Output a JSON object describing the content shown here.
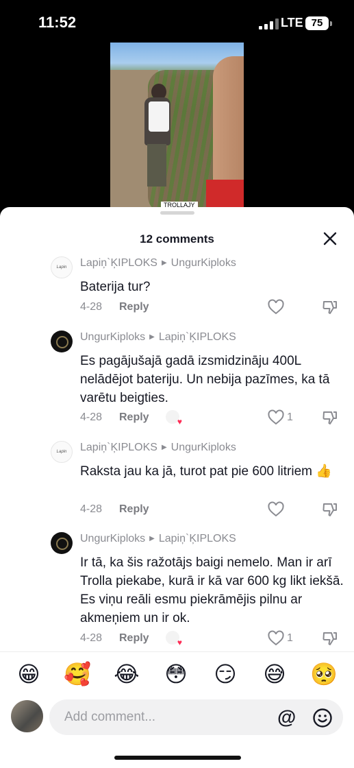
{
  "status_bar": {
    "time": "11:52",
    "network": "LTE",
    "battery": "75"
  },
  "video": {
    "caption": "TROLLAJY"
  },
  "sheet": {
    "title": "12 comments"
  },
  "comments": [
    {
      "author": "Lapiņ`ĶIPLOKS",
      "reply_to": "UngurKiploks",
      "text": "Baterija tur?",
      "date": "4-28",
      "reply_label": "Reply",
      "likes": "",
      "avatar_text": "Lapin ĶIPLOKS"
    },
    {
      "author": "UngurKiploks",
      "reply_to": "Lapiņ`ĶIPLOKS",
      "text": "Es pagājušajā gadā izsmidzināju 400L nelādējot bateriju. Un nebija pazīmes, ka tā varētu beigties.",
      "date": "4-28",
      "reply_label": "Reply",
      "likes": "1"
    },
    {
      "author": "Lapiņ`ĶIPLOKS",
      "reply_to": "UngurKiploks",
      "text": "Raksta jau ka jā, turot pat pie 600 litriem 👍",
      "date": "4-28",
      "reply_label": "Reply",
      "likes": "",
      "avatar_text": "Lapin ĶIPLOKS"
    },
    {
      "author": "UngurKiploks",
      "reply_to": "Lapiņ`ĶIPLOKS",
      "text": "Ir tā, ka šis ražotājs baigi nemelo. Man ir arī Trolla piekabe, kurā ir kā var 600 kg likt iekšā. Es viņu reāli esmu piekrāmējis pilnu ar akmeņiem un ir ok.",
      "date": "4-28",
      "reply_label": "Reply",
      "likes": "1"
    }
  ],
  "emojis": [
    "😁",
    "🥰",
    "😂",
    "😳",
    "😏",
    "😅",
    "🥺"
  ],
  "input": {
    "placeholder": "Add comment...",
    "at_symbol": "@"
  },
  "icons": {
    "close": "close-icon",
    "like": "heart-icon",
    "dislike": "thumbs-down-icon",
    "emoji": "smiley-icon"
  },
  "colors": {
    "accent": "#fe2c55",
    "secondary_text": "#8a8b91"
  }
}
